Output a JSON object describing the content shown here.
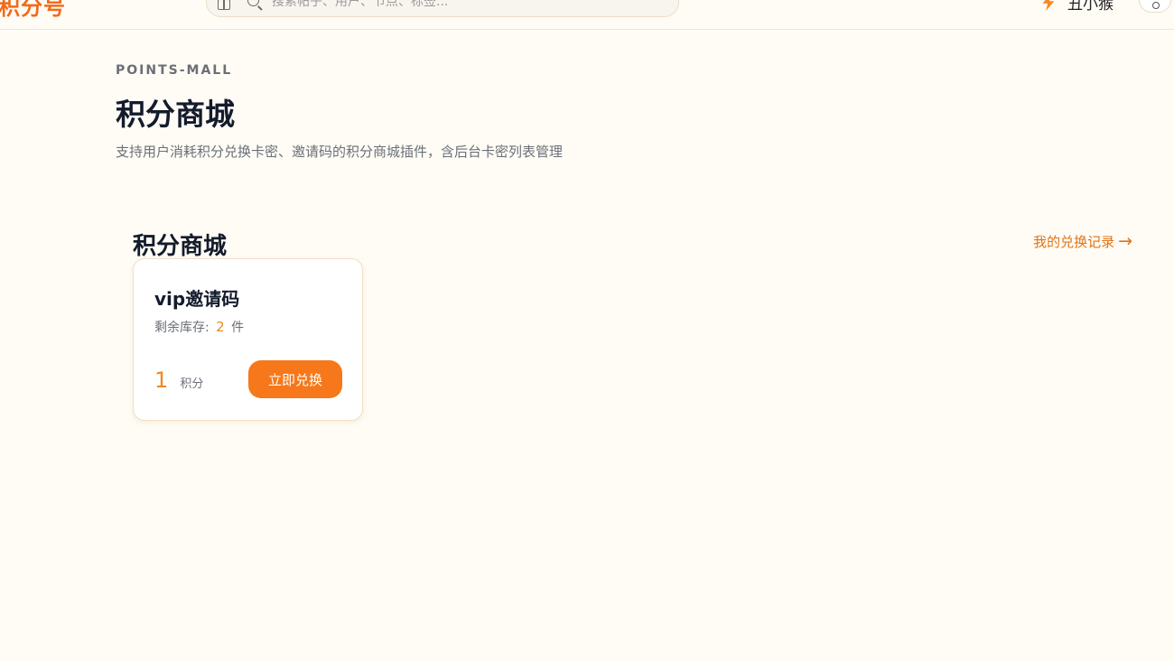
{
  "header": {
    "logo_text": "积分号",
    "search_placeholder": "搜索帖子、用户、节点、标签...",
    "user_name": "丑小猴"
  },
  "page": {
    "eyebrow": "POINTS-MALL",
    "title": "积分商城",
    "description": "支持用户消耗积分兑换卡密、邀请码的积分商城插件，含后台卡密列表管理"
  },
  "section": {
    "title": "积分商城",
    "history_link": "我的兑换记录",
    "history_arrow": "→"
  },
  "products": [
    {
      "name": "vip邀请码",
      "stock_label": "剩余库存:",
      "stock_count": "2",
      "stock_unit": "件",
      "price": "1",
      "price_unit": "积分",
      "button_label": "立即兑换"
    }
  ],
  "colors": {
    "accent": "#f6781a",
    "accent_text": "#f0891d",
    "background": "#fffcf5"
  }
}
